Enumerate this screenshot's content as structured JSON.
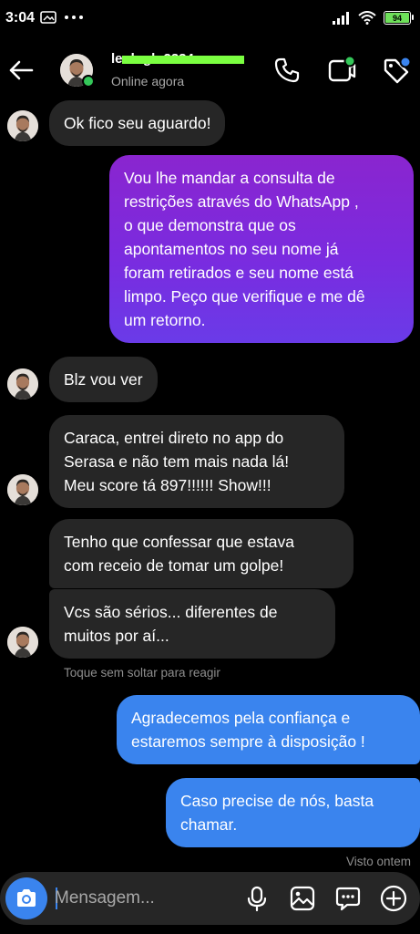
{
  "status_bar": {
    "time": "3:04",
    "battery_level": "94",
    "icons": [
      "photo-notification-icon",
      "more-dots-icon",
      "signal-icon",
      "wifi-icon",
      "battery-icon"
    ]
  },
  "header": {
    "contact_name": "leoh gh 2334",
    "contact_status": "Online agora",
    "online_color": "#34c759",
    "icons": [
      "back-arrow-icon",
      "phone-icon",
      "video-call-icon",
      "tag-icon"
    ]
  },
  "messages": [
    {
      "side": "in",
      "text": "Ok fico seu aguardo!"
    },
    {
      "side": "out",
      "style": "purple",
      "text": "Vou lhe mandar a consulta de\nrestrições através do WhatsApp ,\no que demonstra que os\napontamentos no seu nome já\nforam retirados e seu nome está\nlimpo. Peço que verifique e me dê\num retorno."
    },
    {
      "side": "in",
      "text": "Blz vou ver"
    },
    {
      "side": "in",
      "text": "Caraca, entrei direto no app do\nSerasa e não tem mais nada lá!\nMeu score tá 897!!!!!! Show!!!"
    },
    {
      "side": "in",
      "text": "Tenho que confessar que estava\ncom receio de tomar um golpe!"
    },
    {
      "side": "in",
      "text": "Vcs são sérios... diferentes de\nmuitos por aí..."
    },
    {
      "side": "out",
      "style": "blue",
      "text": "Agradecemos pela confiança e\nestaremos sempre à disposição !"
    },
    {
      "side": "out",
      "style": "blue",
      "text": "Caso precise de nós, basta\nchamar."
    }
  ],
  "hint_text": "Toque sem soltar para reagir",
  "seen_text": "Visto ontem",
  "composer": {
    "placeholder": "Mensagem...",
    "icons": [
      "camera-icon",
      "microphone-icon",
      "gallery-icon",
      "sticker-icon",
      "plus-icon"
    ]
  },
  "colors": {
    "background": "#000000",
    "incoming_bubble": "#262626",
    "outgoing_gradient_start": "#8a25cf",
    "outgoing_gradient_end": "#6a3be8",
    "outgoing_blue": "#3a84ee",
    "accent": "#3a84ee"
  }
}
